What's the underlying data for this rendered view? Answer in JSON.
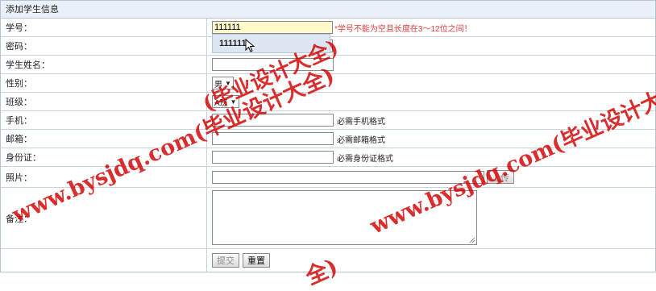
{
  "panel": {
    "title": "添加学生信息"
  },
  "form": {
    "student_id": {
      "label": "学号：",
      "value": "111111",
      "error": "*学号不能为空且长度在3～12位之间！"
    },
    "autocomplete": {
      "suggestion": "111111"
    },
    "password": {
      "label": "密码："
    },
    "name": {
      "label": "学生姓名：",
      "value": ""
    },
    "gender": {
      "label": "性别：",
      "value": "男"
    },
    "class": {
      "label": "班级：",
      "value": "A班"
    },
    "phone": {
      "label": "手机：",
      "value": "",
      "hint": "必需手机格式"
    },
    "email": {
      "label": "邮箱：",
      "value": "",
      "hint": "必需邮箱格式"
    },
    "id_card": {
      "label": "身份证：",
      "value": "",
      "hint": "必需身份证格式"
    },
    "photo": {
      "label": "照片：",
      "value": "",
      "upload_label": "上传"
    },
    "remarks": {
      "label": "备注：",
      "value": ""
    },
    "buttons": {
      "submit": "提交",
      "reset": "重置"
    }
  },
  "watermark": {
    "text1": "www.bysjdq.com(毕业设计大全)",
    "text2": "www.bysjdq.com(毕业设计大",
    "text3": "(毕业设计大全)",
    "text4": "全)",
    "color": "#d20000"
  },
  "icons": {
    "cursor": "mouse-pointer-icon",
    "select_arrow": "triangle-down-icon",
    "resize": "resize-grip-icon"
  }
}
